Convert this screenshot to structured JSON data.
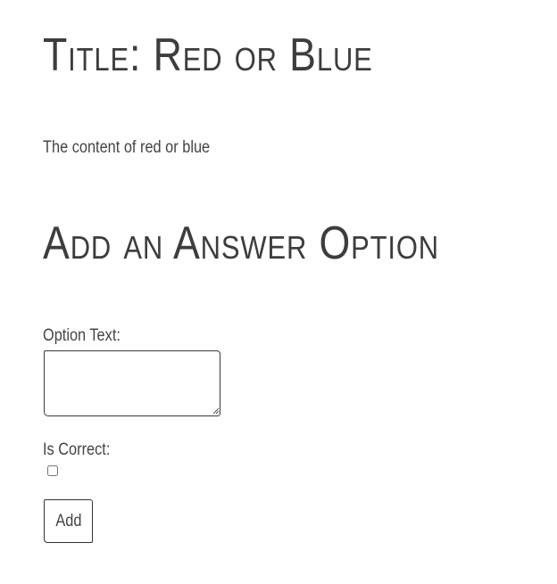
{
  "question": {
    "title": "Title: Red or Blue",
    "content": "The content of red or blue"
  },
  "form": {
    "heading": "Add an Answer Option",
    "option_text_label": "Option Text:",
    "option_text_value": "",
    "is_correct_label": "Is Correct:",
    "is_correct_checked": false,
    "submit_label": "Add"
  },
  "icons": {
    "textarea_grip": "resize-grip-icon"
  },
  "colors": {
    "text": "#404040",
    "border": "#333333",
    "background": "#ffffff"
  }
}
